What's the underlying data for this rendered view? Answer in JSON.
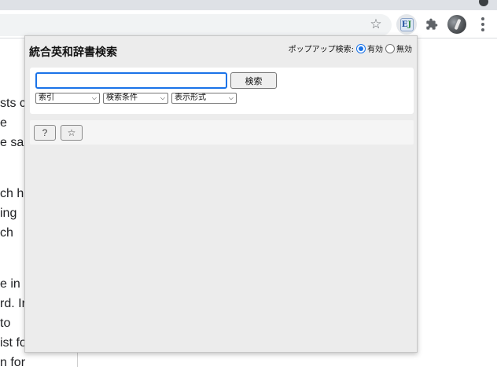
{
  "browser": {
    "icons": [
      "bookmark-star-icon",
      "extension-eiwa-icon",
      "extensions-puzzle-icon",
      "profile-avatar",
      "more-menu-icon"
    ]
  },
  "background_page": {
    "lines": [
      "sts c",
      "e",
      "e sa",
      "ch h",
      "ing",
      "ch",
      "e in",
      "rd. Ir",
      "to",
      "ist fo",
      "n for"
    ]
  },
  "popup": {
    "title": "統合英和辞書検索",
    "popup_search": {
      "label": "ポップアップ検索:",
      "options": [
        "有効",
        "無効"
      ],
      "selected": "有効"
    },
    "search": {
      "input_value": "",
      "button_label": "検索"
    },
    "selects": {
      "index": "索引",
      "condition": "検索条件",
      "format": "表示形式"
    },
    "tools": {
      "help_label": "?",
      "favorite_label": "☆"
    }
  }
}
